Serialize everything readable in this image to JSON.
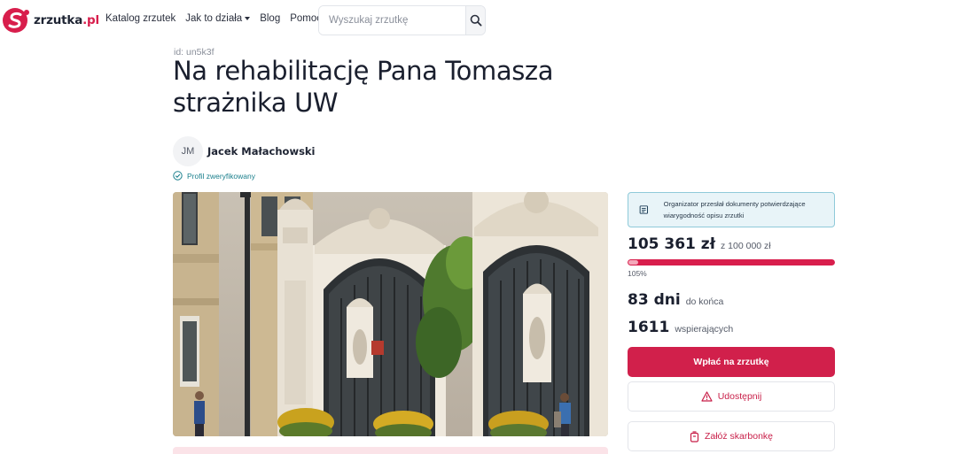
{
  "brand": {
    "name": "zrzutka",
    "tld": ".pl",
    "accent": "#d81e4c"
  },
  "nav": {
    "items": [
      {
        "label": "Katalog zrzutek"
      },
      {
        "label": "Jak to działa",
        "has_dropdown": true
      },
      {
        "label": "Blog"
      },
      {
        "label": "Pomoc"
      }
    ]
  },
  "search": {
    "placeholder": "Wyszukaj zrzutkę",
    "value": "",
    "icon": "search-icon"
  },
  "campaign": {
    "id_label": "id: un5k3f",
    "title": "Na rehabilitację Pana Tomasza strażnika UW",
    "organizer_initials": "JM",
    "organizer_name": "Jacek Małachowski",
    "verified_label": "Profil zweryfikowany",
    "image_subject": "university gate with baroque ornamented pillars and iron gates"
  },
  "sidebar": {
    "docs_notice": "Organizator przesłał dokumenty potwierdzające wiarygodność opisu zrzutki",
    "raised": "105 361 zł",
    "goal": "z 100 000 zł",
    "progress_percent": 105,
    "progress_label": "105%",
    "days": "83 dni",
    "days_label": "do końca",
    "supporters": "1611",
    "supporters_label": "wspierających",
    "donate_button": "Wpłać na zrzutkę",
    "share_button": "Udostępnij",
    "piggybank_button": "Załóż skarbonkę"
  },
  "colors": {
    "primary": "#d1204b",
    "progress_track": "#f6c9d4",
    "verified": "#1a7f8c",
    "notice_bg": "#e8f4f8",
    "notice_border": "#8fcad9"
  }
}
